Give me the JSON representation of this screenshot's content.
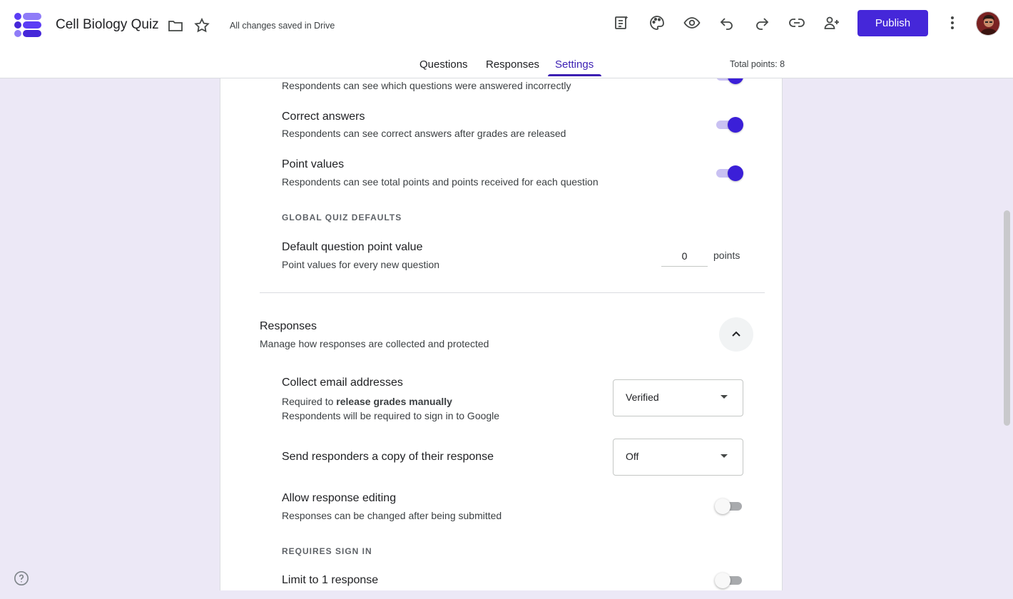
{
  "header": {
    "title": "Cell Biology Quiz",
    "saved_status": "All changes saved in Drive",
    "publish_label": "Publish"
  },
  "tabs": [
    {
      "label": "Questions",
      "active": false
    },
    {
      "label": "Responses",
      "active": false
    },
    {
      "label": "Settings",
      "active": true
    }
  ],
  "total_points": "Total points: 8",
  "quiz_release": {
    "missed_questions_desc": "Respondents can see which questions were answered incorrectly",
    "missed_questions_on": true,
    "correct_answers_title": "Correct answers",
    "correct_answers_desc": "Respondents can see correct answers after grades are released",
    "correct_answers_on": true,
    "point_values_title": "Point values",
    "point_values_desc": "Respondents can see total points and points received for each question",
    "point_values_on": true
  },
  "global_defaults": {
    "label": "GLOBAL QUIZ DEFAULTS",
    "default_point_title": "Default question point value",
    "default_point_desc": "Point values for every new question",
    "default_point_value": "0",
    "points_unit": "points"
  },
  "responses_section": {
    "title": "Responses",
    "desc": "Manage how responses are collected and protected",
    "collect_email_title": "Collect email addresses",
    "collect_email_desc_prefix": "Required to ",
    "collect_email_desc_bold": "release grades manually",
    "collect_email_desc2": "Respondents will be required to sign in to Google",
    "collect_email_value": "Verified",
    "send_copy_title": "Send responders a copy of their response",
    "send_copy_value": "Off",
    "allow_editing_title": "Allow response editing",
    "allow_editing_desc": "Responses can be changed after being submitted",
    "allow_editing_on": false,
    "requires_sign_in_label": "REQUIRES SIGN IN",
    "limit_response_title": "Limit to 1 response",
    "limit_response_on": false
  },
  "colors": {
    "accent": "#4527d9",
    "toggle_on": "#3b1fd8",
    "background": "#ece8f6"
  },
  "icons": [
    "forms-logo-icon",
    "folder-icon",
    "star-icon",
    "customize-apply-icon",
    "palette-icon",
    "eye-icon",
    "undo-icon",
    "redo-icon",
    "link-icon",
    "add-person-icon",
    "more-vert-icon",
    "chevron-up-icon",
    "help-icon"
  ]
}
